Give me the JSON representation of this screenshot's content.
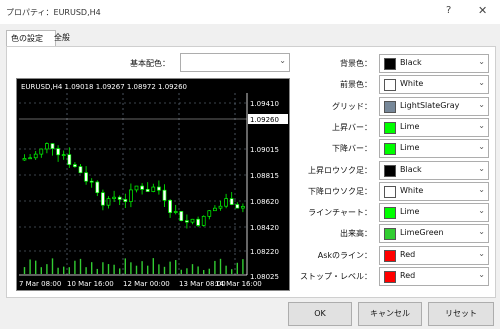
{
  "window": {
    "title": "プロパティ：EURUSD,H4",
    "help": "?",
    "close": "✕"
  },
  "tabs": [
    "色の設定",
    "全般"
  ],
  "scheme": {
    "label": "基本配色：",
    "value": ""
  },
  "chart": {
    "header": "EURUSD,H4  1.09018 1.09267 1.08972 1.09260",
    "current_price": "1.09260",
    "y_labels": [
      "1.09410",
      "1.09260",
      "1.09015",
      "1.08815",
      "1.08620",
      "1.08420",
      "1.08220",
      "1.08025"
    ],
    "x_labels": [
      "7 Mar 08:00",
      "10 Mar 16:00",
      "12 Mar 00:00",
      "13 Mar 08:00",
      "14 Mar 16:00"
    ],
    "colors": {
      "background": "#000000",
      "grid": "#778899",
      "up": "#00ff00",
      "down": "#00ff00",
      "bull_body": "#000000",
      "bear_body": "#ffffff",
      "volume": "#32cd32",
      "ask": "#ff0000"
    }
  },
  "settings": [
    {
      "label": "背景色：",
      "color_name": "Black",
      "hex": "#000000"
    },
    {
      "label": "前景色：",
      "color_name": "White",
      "hex": "#ffffff"
    },
    {
      "label": "グリッド：",
      "color_name": "LightSlateGray",
      "hex": "#778899"
    },
    {
      "label": "上昇バー：",
      "color_name": "Lime",
      "hex": "#00ff00"
    },
    {
      "label": "下降バー：",
      "color_name": "Lime",
      "hex": "#00ff00"
    },
    {
      "label": "上昇ロウソク足：",
      "color_name": "Black",
      "hex": "#000000"
    },
    {
      "label": "下降ロウソク足：",
      "color_name": "White",
      "hex": "#ffffff"
    },
    {
      "label": "ラインチャート：",
      "color_name": "Lime",
      "hex": "#00ff00"
    },
    {
      "label": "出来高：",
      "color_name": "LimeGreen",
      "hex": "#32cd32"
    },
    {
      "label": "Askのライン：",
      "color_name": "Red",
      "hex": "#ff0000"
    },
    {
      "label": "ストップ・レベル：",
      "color_name": "Red",
      "hex": "#ff0000"
    }
  ],
  "buttons": {
    "ok": "OK",
    "cancel": "キャンセル",
    "reset": "リセット"
  }
}
